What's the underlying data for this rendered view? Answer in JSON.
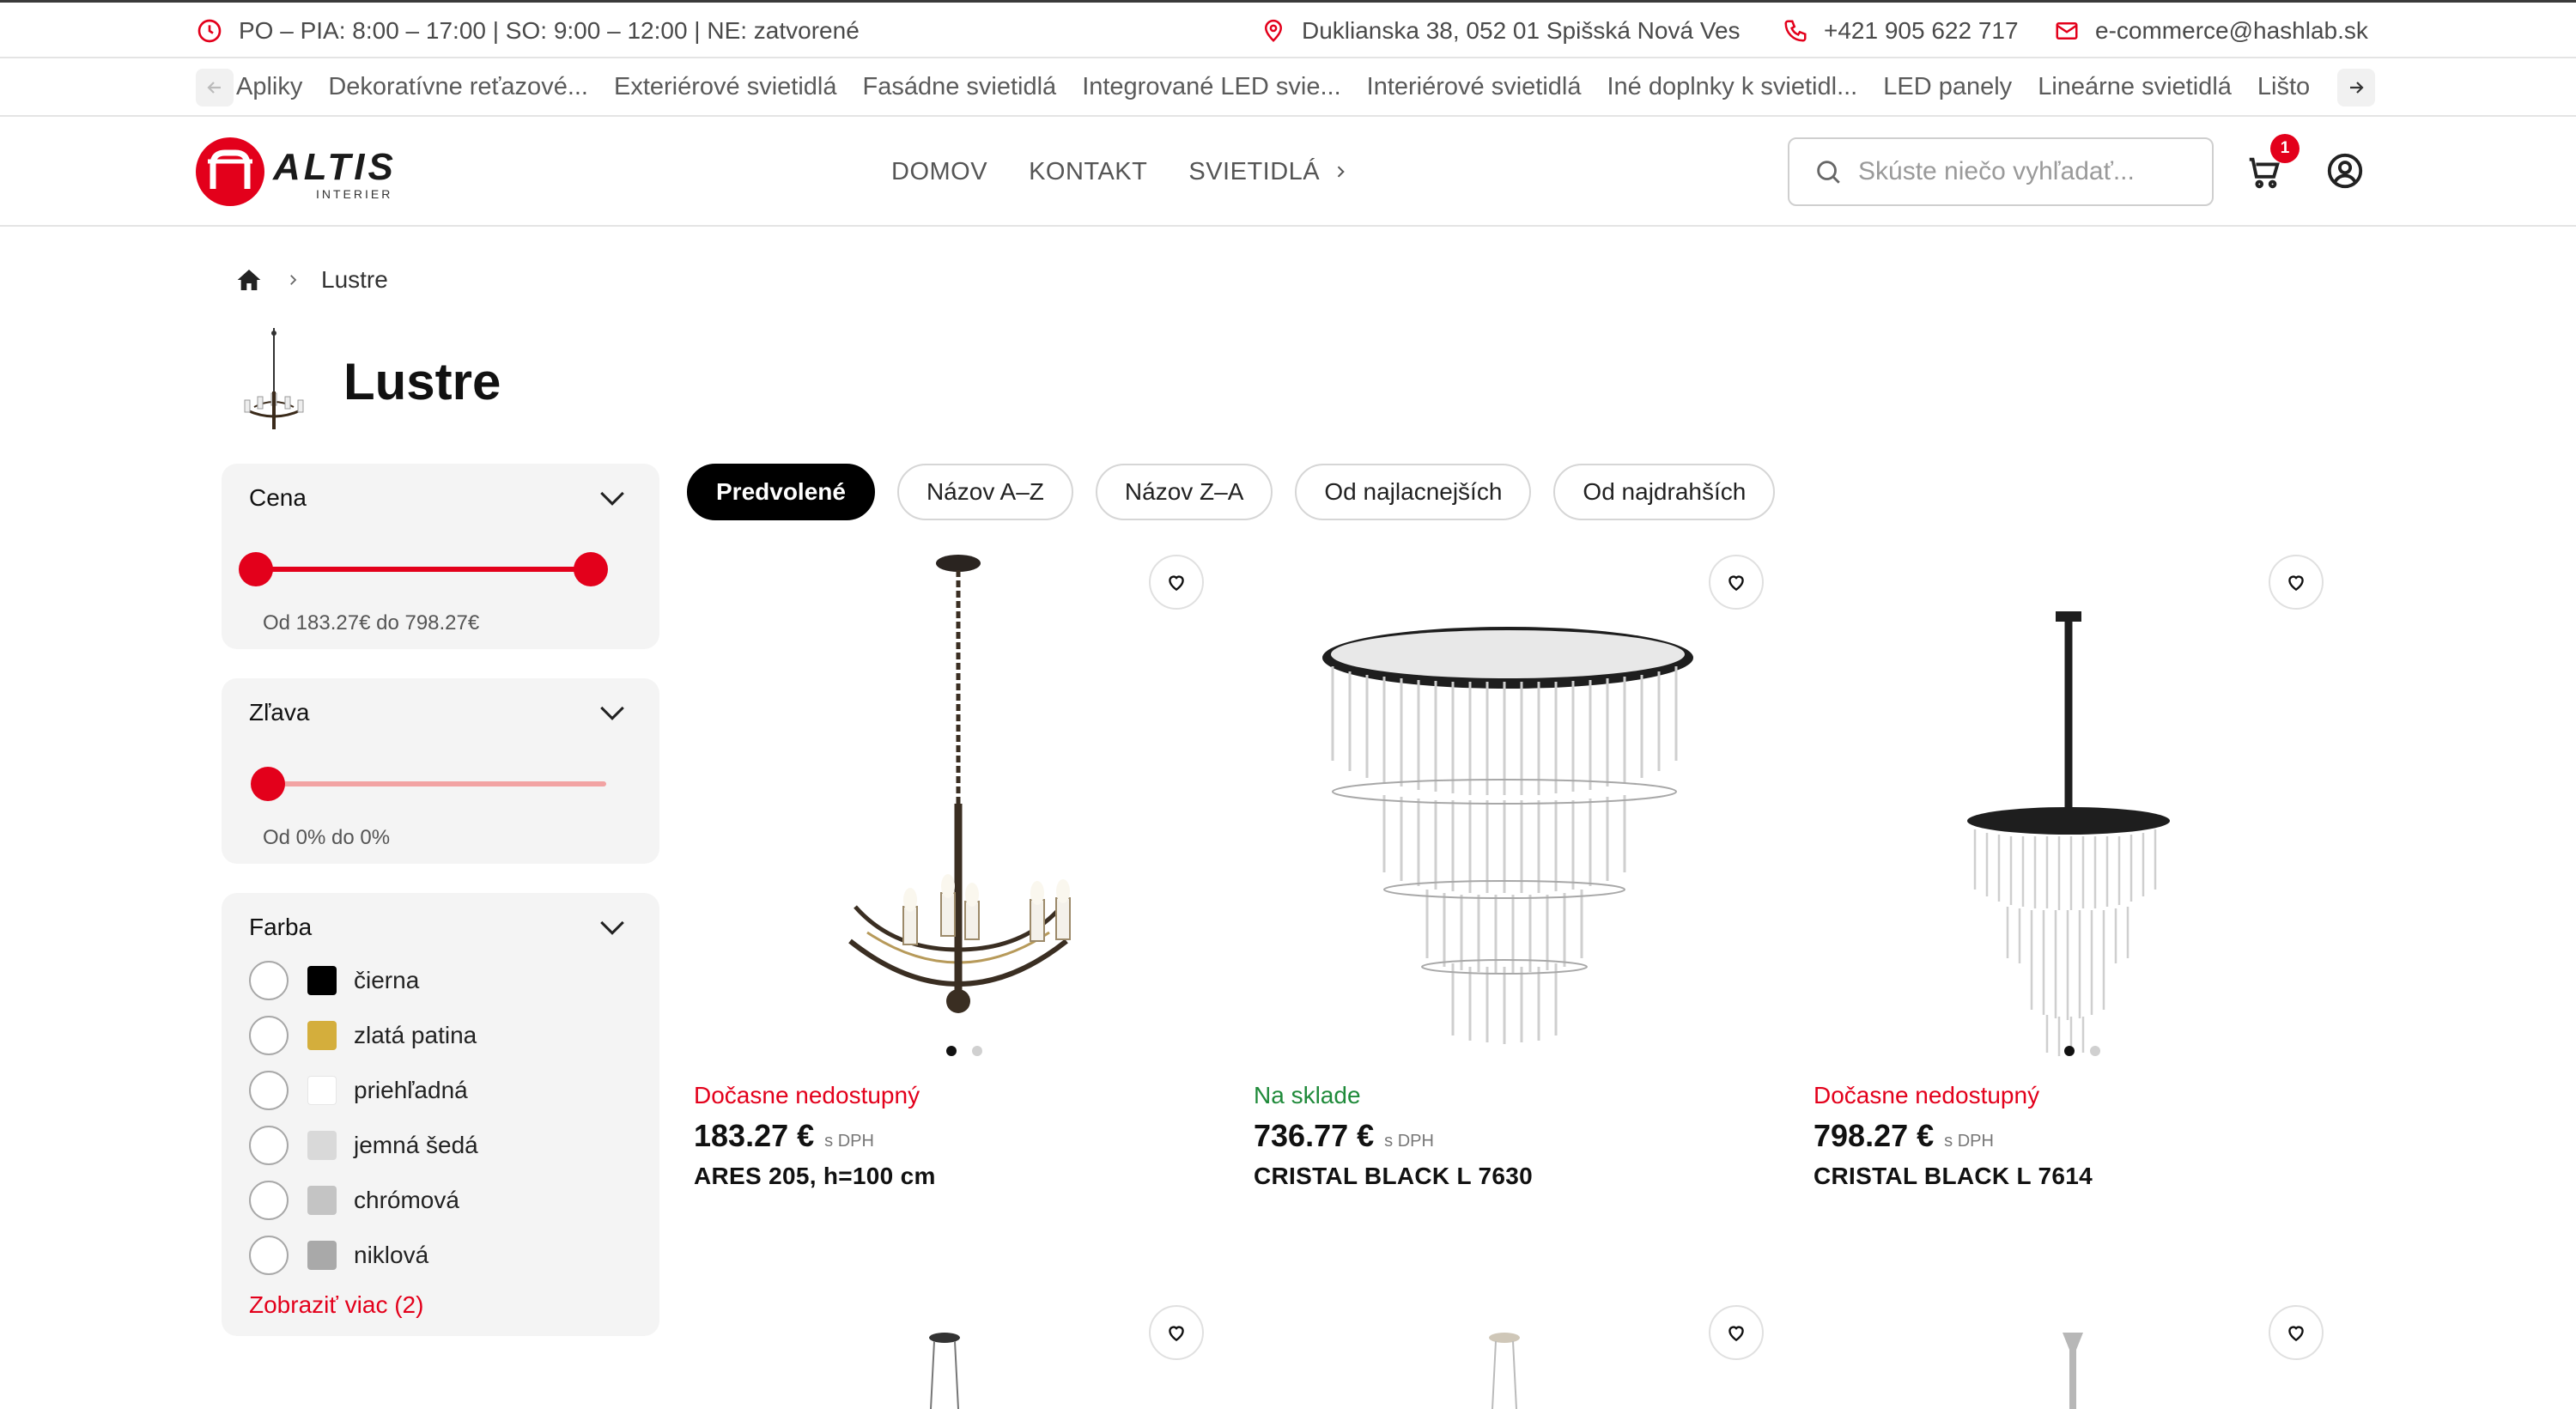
{
  "topbar": {
    "hours": "PO – PIA: 8:00 – 17:00 | SO: 9:00 – 12:00 | NE: zatvorené",
    "address": "Duklianska 38, 052 01 Spišská Nová Ves",
    "phone": "+421 905 622 717",
    "email": "e-commerce@hashlab.sk"
  },
  "categories": [
    "Apliky",
    "Dekoratívne reťazové...",
    "Exteriérové svietidlá",
    "Fasádne svietidlá",
    "Integrované LED svie...",
    "Interiérové svietidlá",
    "Iné doplnky k svietidl...",
    "LED panely",
    "Lineárne svietidlá",
    "Lišto"
  ],
  "header": {
    "logo_text": "ALTIS",
    "logo_sub": "INTERIER",
    "nav": [
      "DOMOV",
      "KONTAKT",
      "SVIETIDLÁ"
    ],
    "search_placeholder": "Skúste niečo vyhľadať...",
    "cart_count": "1"
  },
  "breadcrumb": {
    "current": "Lustre"
  },
  "page_title": "Lustre",
  "filters": {
    "price": {
      "title": "Cena",
      "range_text": "Od 183.27€ do 798.27€"
    },
    "discount": {
      "title": "Zľava",
      "range_text": "Od 0% do 0%"
    },
    "color": {
      "title": "Farba",
      "options": [
        {
          "label": "čierna",
          "swatch": "#000000"
        },
        {
          "label": "zlatá patina",
          "swatch": "#d4ae3c"
        },
        {
          "label": "priehľadná",
          "swatch": "#ffffff"
        },
        {
          "label": "jemná šedá",
          "swatch": "#d9d9d9"
        },
        {
          "label": "chrómová",
          "swatch": "#c4c4c4"
        },
        {
          "label": "niklová",
          "swatch": "#a9a9a9"
        }
      ],
      "show_more": "Zobraziť viac (2)"
    }
  },
  "sort": [
    "Predvolené",
    "Názov A–Z",
    "Názov Z–A",
    "Od najlacnejších",
    "Od najdrahších"
  ],
  "products": [
    {
      "status": "Dočasne nedostupný",
      "status_color": "#e3001b",
      "price": "183.27 €",
      "vat": "s DPH",
      "name": "ARES 205, h=100 cm"
    },
    {
      "status": "Na sklade",
      "status_color": "#1f8a3a",
      "price": "736.77 €",
      "vat": "s DPH",
      "name": "CRISTAL BLACK L 7630"
    },
    {
      "status": "Dočasne nedostupný",
      "status_color": "#e3001b",
      "price": "798.27 €",
      "vat": "s DPH",
      "name": "CRISTAL BLACK L 7614"
    }
  ],
  "colors": {
    "accent": "#e3001b",
    "in_stock": "#1f8a3a"
  }
}
